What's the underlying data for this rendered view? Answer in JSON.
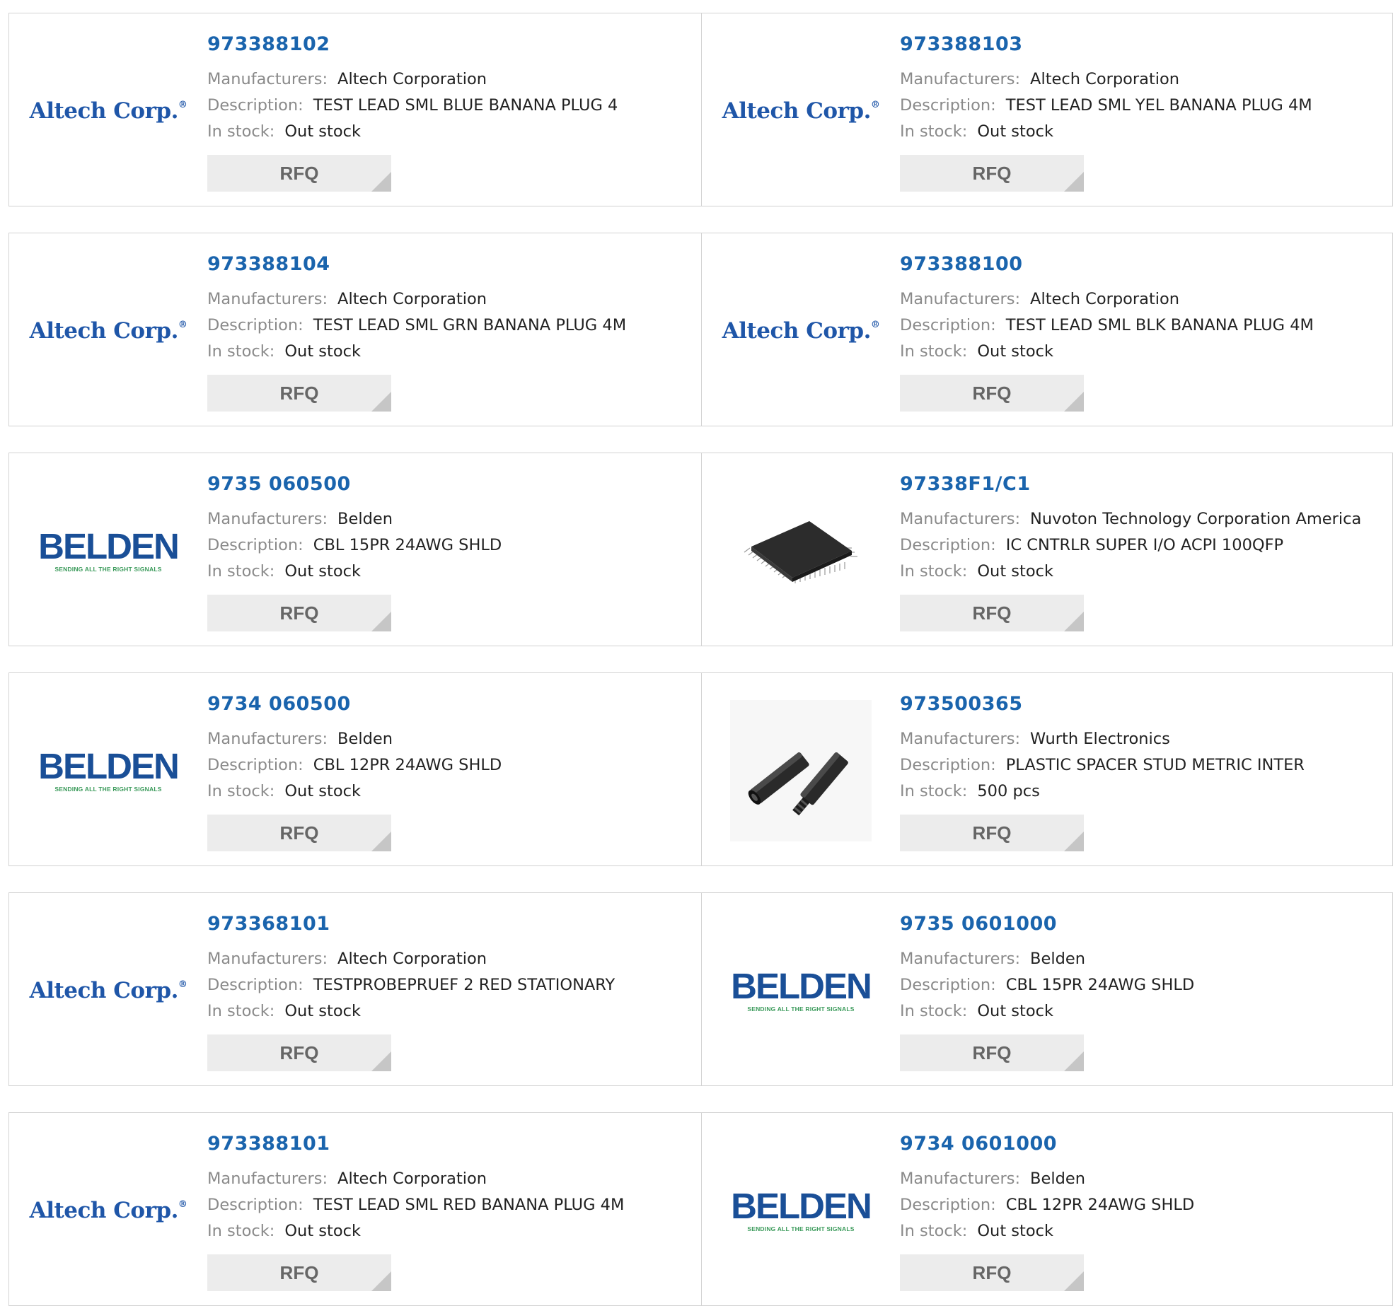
{
  "labels": {
    "manufacturers": "Manufacturers:",
    "description": "Description:",
    "in_stock": "In stock:",
    "rfq": "RFQ"
  },
  "logo_text": {
    "altech": "Altech Corp.",
    "altech_mark": "®",
    "belden": "BELDEN",
    "belden_tagline": "SENDING ALL THE RIGHT SIGNALS"
  },
  "colors": {
    "part_number_link": "#1a64ad",
    "label_gray": "#8a8a8a",
    "rfq_bg": "#ececec",
    "border": "#d2d2d2"
  },
  "products": [
    {
      "part_number": "973388102",
      "manufacturer": "Altech Corporation",
      "description": "TEST LEAD SML BLUE BANANA PLUG 4",
      "stock": "Out stock",
      "image": "altech-logo"
    },
    {
      "part_number": "973388103",
      "manufacturer": "Altech Corporation",
      "description": "TEST LEAD SML YEL BANANA PLUG 4M",
      "stock": "Out stock",
      "image": "altech-logo"
    },
    {
      "part_number": "973388104",
      "manufacturer": "Altech Corporation",
      "description": "TEST LEAD SML GRN BANANA PLUG 4M",
      "stock": "Out stock",
      "image": "altech-logo"
    },
    {
      "part_number": "973388100",
      "manufacturer": "Altech Corporation",
      "description": "TEST LEAD SML BLK BANANA PLUG 4M",
      "stock": "Out stock",
      "image": "altech-logo"
    },
    {
      "part_number": "9735 060500",
      "manufacturer": "Belden",
      "description": "CBL 15PR 24AWG SHLD",
      "stock": "Out stock",
      "image": "belden-logo"
    },
    {
      "part_number": "97338F1/C1",
      "manufacturer": "Nuvoton Technology Corporation America",
      "description": "IC CNTRLR SUPER I/O ACPI 100QFP",
      "stock": "Out stock",
      "image": "qfp-chip-photo"
    },
    {
      "part_number": "9734 060500",
      "manufacturer": "Belden",
      "description": "CBL 12PR 24AWG SHLD",
      "stock": "Out stock",
      "image": "belden-logo"
    },
    {
      "part_number": "973500365",
      "manufacturer": "Wurth Electronics",
      "description": "PLASTIC SPACER STUD METRIC INTER",
      "stock": "500 pcs",
      "image": "spacer-stud-photo"
    },
    {
      "part_number": "973368101",
      "manufacturer": "Altech Corporation",
      "description": "TESTPROBEPRUEF 2 RED STATIONARY",
      "stock": "Out stock",
      "image": "altech-logo"
    },
    {
      "part_number": "9735 0601000",
      "manufacturer": "Belden",
      "description": "CBL 15PR 24AWG SHLD",
      "stock": "Out stock",
      "image": "belden-logo"
    },
    {
      "part_number": "973388101",
      "manufacturer": "Altech Corporation",
      "description": "TEST LEAD SML RED BANANA PLUG 4M",
      "stock": "Out stock",
      "image": "altech-logo"
    },
    {
      "part_number": "9734 0601000",
      "manufacturer": "Belden",
      "description": "CBL 12PR 24AWG SHLD",
      "stock": "Out stock",
      "image": "belden-logo"
    }
  ]
}
